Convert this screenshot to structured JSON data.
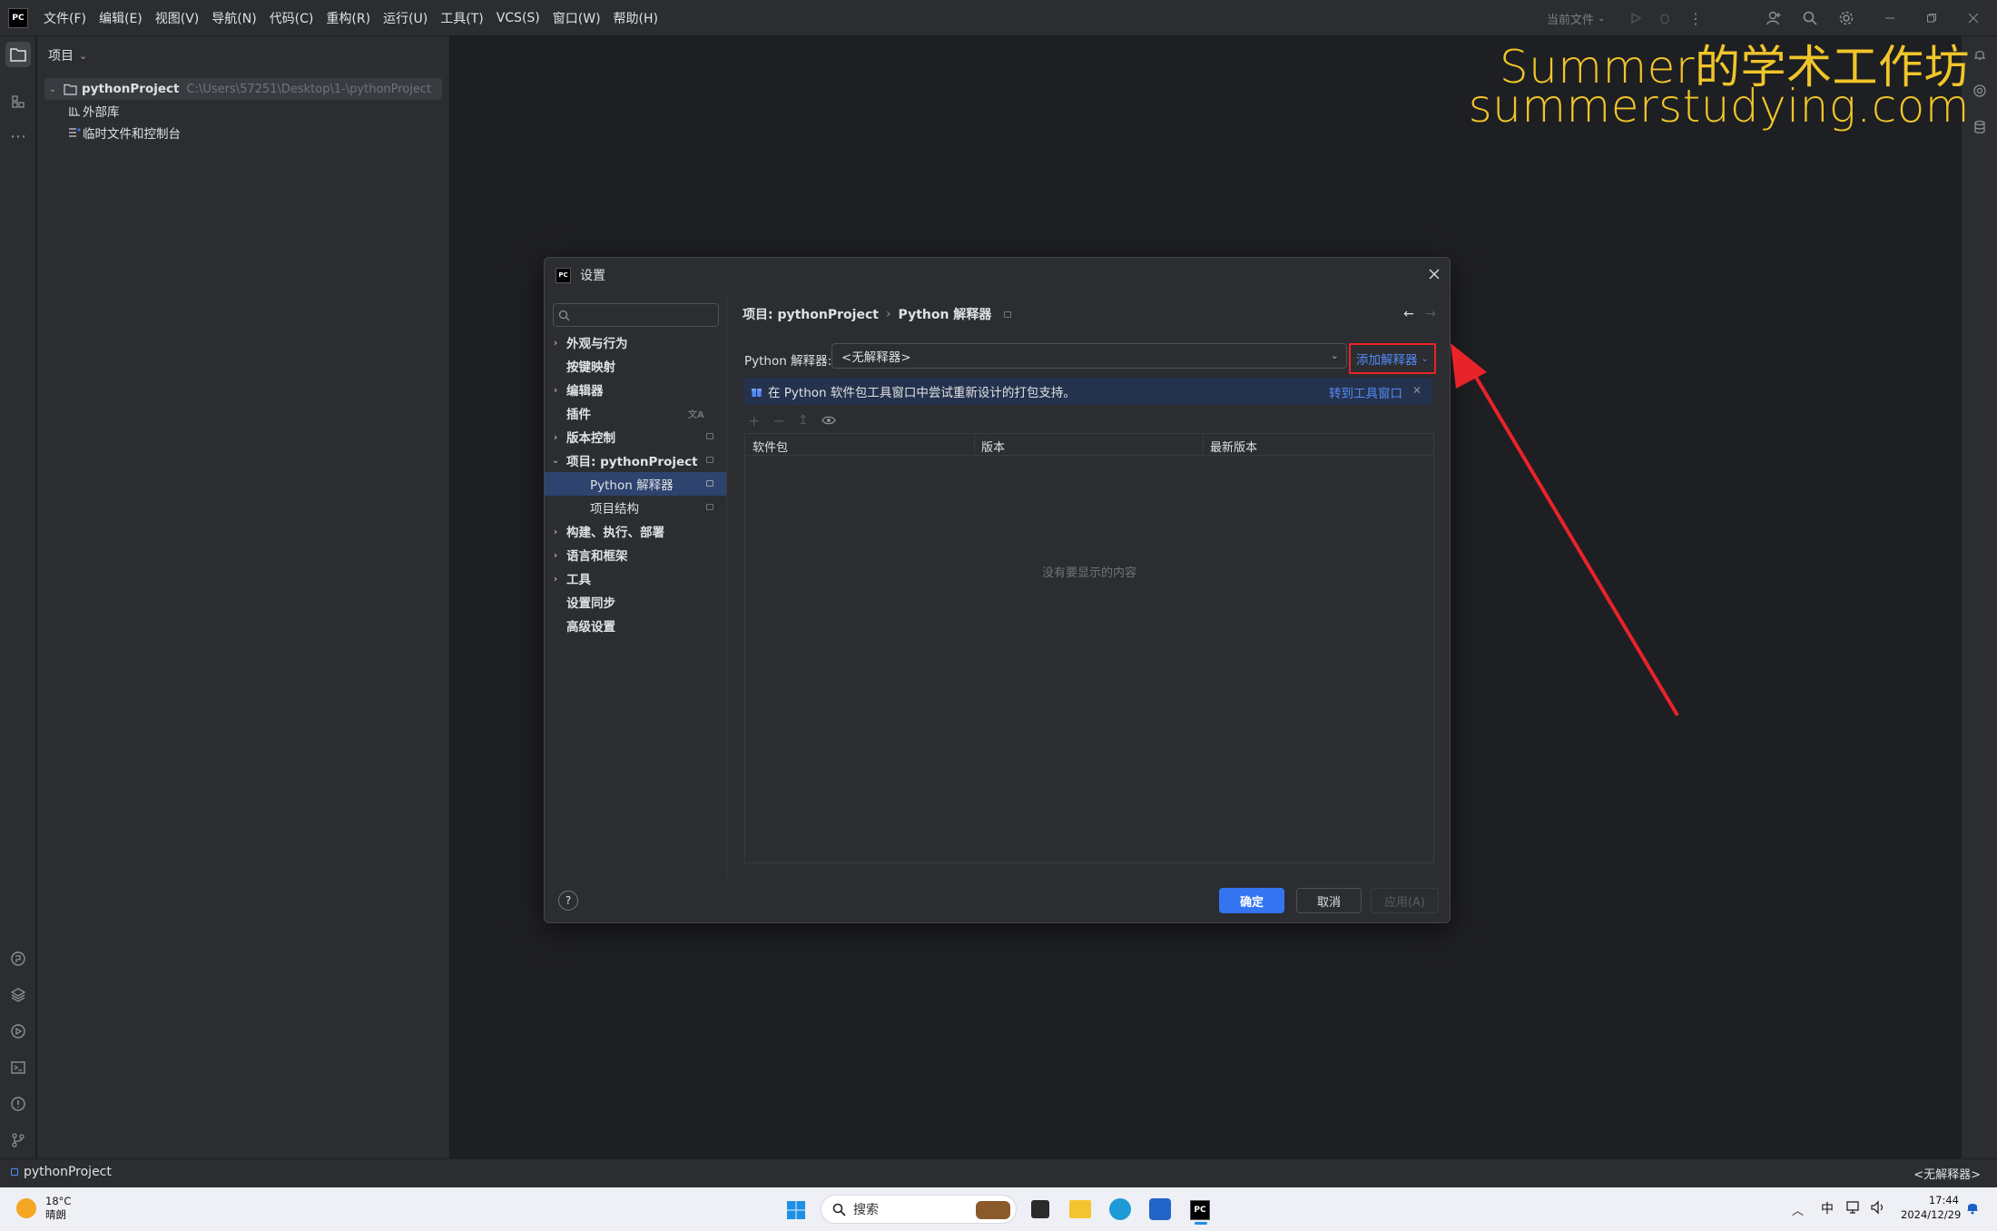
{
  "menubar": {
    "items": [
      "文件(F)",
      "编辑(E)",
      "视图(V)",
      "导航(N)",
      "代码(C)",
      "重构(R)",
      "运行(U)",
      "工具(T)",
      "VCS(S)",
      "窗口(W)",
      "帮助(H)"
    ],
    "run_config": "当前文件"
  },
  "project_panel": {
    "title": "项目",
    "root_name": "pythonProject",
    "root_path": "C:\\Users\\57251\\Desktop\\1-\\pythonProject",
    "external_libs": "外部库",
    "scratches": "临时文件和控制台"
  },
  "watermark": {
    "line1": "Summer的学术工作坊",
    "line2": "summerstudying.com"
  },
  "dialog": {
    "title": "设置",
    "search_placeholder": "",
    "nav": [
      {
        "label": "外观与行为",
        "expandable": true
      },
      {
        "label": "按键映射",
        "expandable": false
      },
      {
        "label": "编辑器",
        "expandable": true
      },
      {
        "label": "插件",
        "expandable": false
      },
      {
        "label": "版本控制",
        "expandable": true
      },
      {
        "label": "项目: pythonProject",
        "expandable": true,
        "expanded": true
      },
      {
        "label": "Python 解释器",
        "child": true,
        "selected": true
      },
      {
        "label": "项目结构",
        "child": true
      },
      {
        "label": "构建、执行、部署",
        "expandable": true
      },
      {
        "label": "语言和框架",
        "expandable": true
      },
      {
        "label": "工具",
        "expandable": true
      },
      {
        "label": "设置同步",
        "expandable": false
      },
      {
        "label": "高级设置",
        "expandable": false
      }
    ],
    "breadcrumb_project": "项目: pythonProject",
    "breadcrumb_sep": "›",
    "breadcrumb_page": "Python 解释器",
    "interpreter_label": "Python 解释器:",
    "interpreter_value": "<无解释器>",
    "add_interpreter": "添加解释器",
    "banner_text": "在 Python 软件包工具窗口中尝试重新设计的打包支持。",
    "banner_link": "转到工具窗口",
    "table_headers": [
      "软件包",
      "版本",
      "最新版本"
    ],
    "empty_text": "没有要显示的内容",
    "ok": "确定",
    "cancel": "取消",
    "apply": "应用(A)",
    "help": "?"
  },
  "statusbar": {
    "project": "pythonProject",
    "interpreter": "<无解释器>"
  },
  "taskbar": {
    "temperature": "18°C",
    "weather": "晴朗",
    "search": "搜索",
    "ime": "中",
    "time": "17:44",
    "date": "2024/12/29"
  },
  "colors": {
    "accent": "#3574f0",
    "annotation_red": "#e8232a",
    "watermark": "#f0c52a",
    "selection": "#2e436e"
  }
}
